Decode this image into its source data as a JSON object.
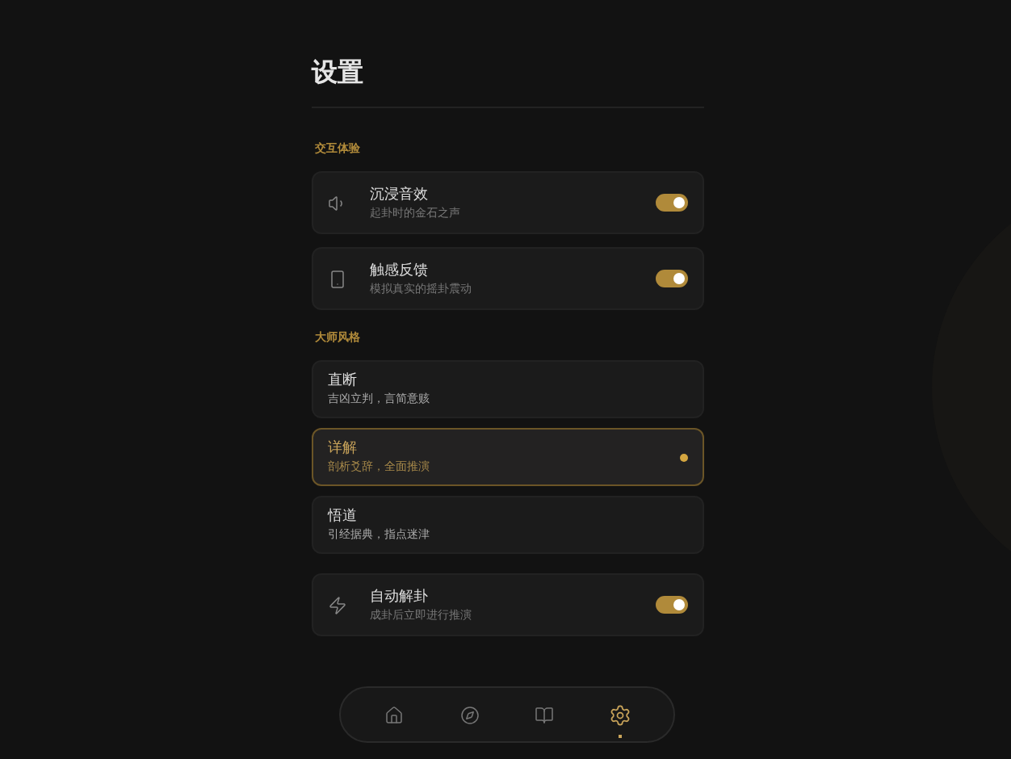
{
  "title": "设置",
  "sections": [
    {
      "label": "交互体验",
      "items": [
        {
          "kind": "toggle",
          "title": "沉浸音效",
          "subtitle": "起卦时的金石之声",
          "on": true
        },
        {
          "kind": "toggle",
          "title": "触感反馈",
          "subtitle": "模拟真实的摇卦震动",
          "on": true
        }
      ]
    },
    {
      "label": "大师风格",
      "items": [
        {
          "kind": "choice",
          "title": "直断",
          "subtitle": "吉凶立判，言简意赅",
          "selected": false
        },
        {
          "kind": "choice",
          "title": "详解",
          "subtitle": "剖析爻辞，全面推演",
          "selected": true
        },
        {
          "kind": "choice",
          "title": "悟道",
          "subtitle": "引经据典，指点迷津",
          "selected": false
        }
      ]
    },
    {
      "items": [
        {
          "kind": "toggle",
          "title": "自动解卦",
          "subtitle": "成卦后立即进行推演",
          "on": true
        }
      ]
    }
  ],
  "nav": [
    {
      "selected": false
    },
    {
      "selected": false
    },
    {
      "selected": false
    },
    {
      "selected": true
    }
  ]
}
